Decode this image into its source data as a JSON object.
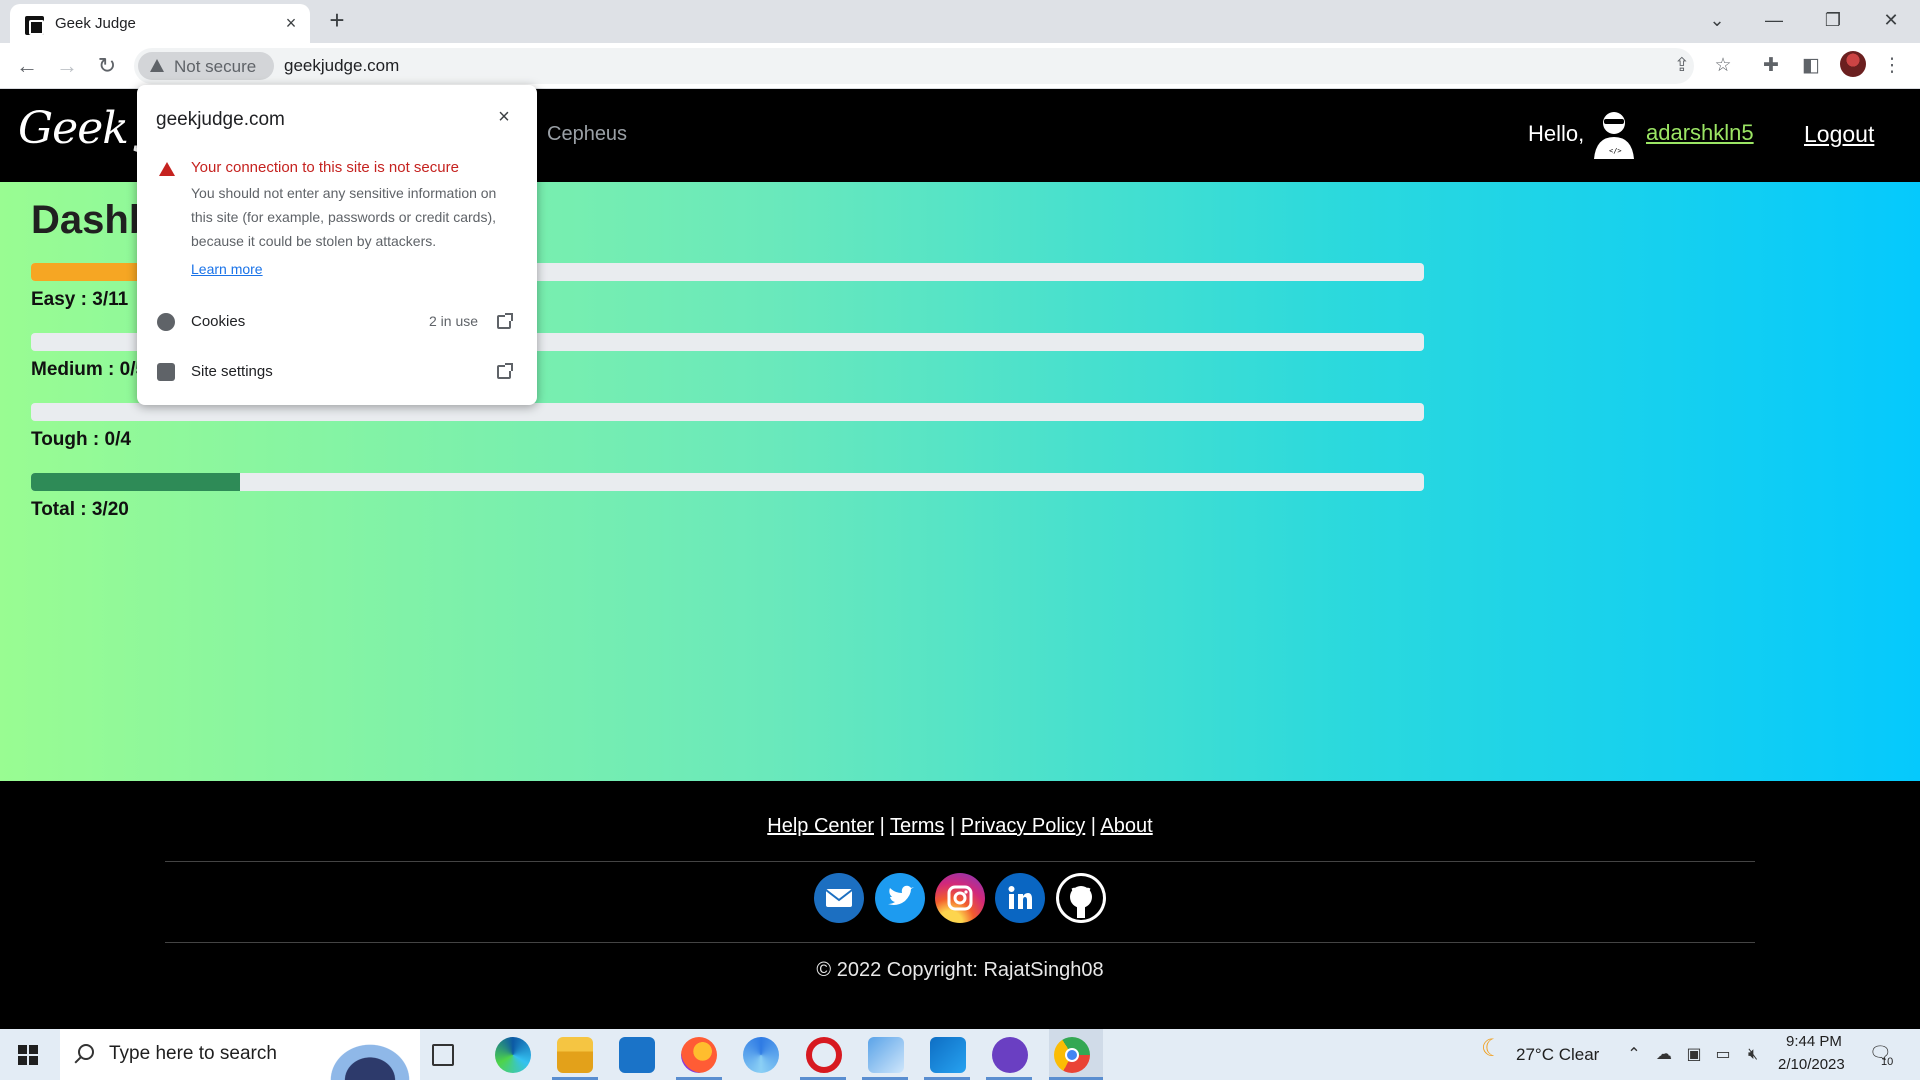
{
  "browser": {
    "tab_title": "Geek Judge",
    "tab_close": "×",
    "new_tab": "+",
    "security_chip": "Not secure",
    "url": "geekjudge.com"
  },
  "site": {
    "logo_text": "Geek Judge",
    "nav_link": "Cepheus",
    "hello": "Hello,",
    "username": "adarshkln5",
    "logout": "Logout",
    "username_color": "#9be564"
  },
  "dashboard": {
    "title": "Dashboard",
    "bars": [
      {
        "label": "Easy : 3/11",
        "solved": 3,
        "total": 11,
        "color": "#f6a623"
      },
      {
        "label": "Medium : 0/5",
        "solved": 0,
        "total": 5,
        "color": "#f6a623"
      },
      {
        "label": "Tough : 0/4",
        "solved": 0,
        "total": 4,
        "color": "#dc3545"
      },
      {
        "label": "Total : 3/20",
        "solved": 3,
        "total": 20,
        "color": "#2e8b57"
      }
    ]
  },
  "popup": {
    "host": "geekjudge.com",
    "close": "×",
    "warning_title": "Your connection to this site is not secure",
    "warning_text": "You should not enter any sensitive information on this site (for example, passwords or credit cards), because it could be stolen by attackers.",
    "learn_more": "Learn more",
    "cookies_label": "Cookies",
    "cookies_meta": "2 in use",
    "site_settings_label": "Site settings"
  },
  "footer": {
    "links": [
      "Help Center",
      "Terms",
      "Privacy Policy",
      "About"
    ],
    "separator": "|",
    "socials": [
      "mail-icon",
      "twitter-icon",
      "instagram-icon",
      "linkedin-icon",
      "github-icon"
    ],
    "copyright": "© 2022 Copyright: RajatSingh08"
  },
  "taskbar": {
    "search_placeholder": "Type here to search",
    "weather": "27°C  Clear",
    "time": "9:44 PM",
    "date": "2/10/2023",
    "notification_count": "10"
  }
}
